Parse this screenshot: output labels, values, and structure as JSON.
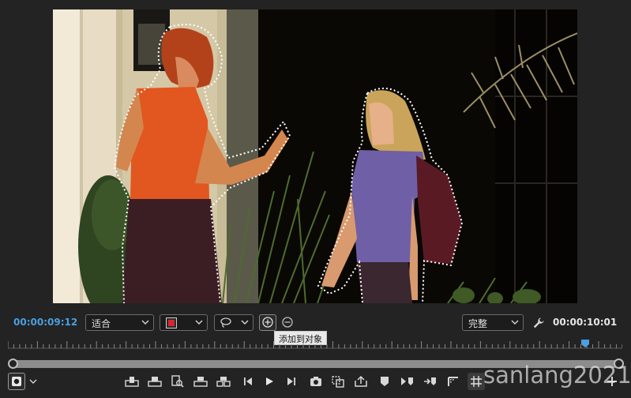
{
  "viewer": {
    "timecode_current": "00:00:09:12",
    "timecode_duration": "00:00:10:01"
  },
  "controls": {
    "fit_label": "适合",
    "quality_label": "完整",
    "tooltip": "添加到对象",
    "mask_color": "#d9262e",
    "accent": "#4a9fe0"
  },
  "icons": {
    "add_object": "plus-circle-icon",
    "subtract_object": "minus-circle-icon",
    "lasso": "lasso-icon",
    "wrench": "wrench-icon",
    "settings": "record-square-icon"
  },
  "watermark": "sanlang2021"
}
